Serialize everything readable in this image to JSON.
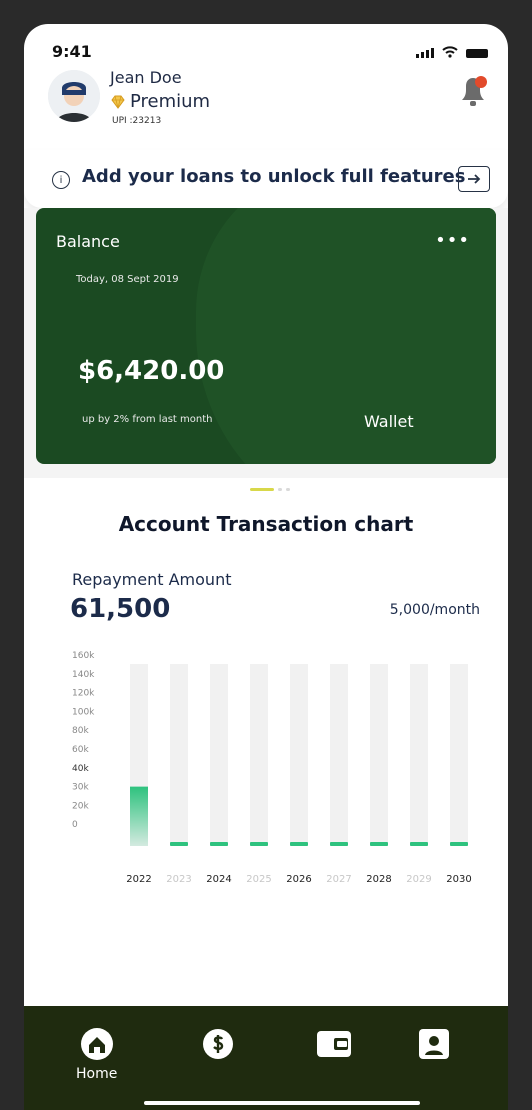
{
  "status": {
    "time": "9:41"
  },
  "profile": {
    "name": "Jean Doe",
    "plan": "Premium",
    "upi": "UPI :23213"
  },
  "banner": {
    "text": "Add your loans to unlock full features"
  },
  "balance_card": {
    "label": "Balance",
    "date": "Today, 08 Sept 2019",
    "amount": "$6,420.00",
    "change": "up by 2% from last month",
    "wallet": "Wallet",
    "more": "•••"
  },
  "section": {
    "title": "Account Transaction chart",
    "repayment_label": "Repayment Amount",
    "repayment_value": "61,500",
    "repayment_rate": "5,000/month"
  },
  "colors": {
    "accent": "#2ec27e",
    "card_green": "#1b4a22",
    "nav_bg": "#1f2b0f"
  },
  "chart_data": {
    "type": "bar",
    "categories": [
      "2022",
      "2023",
      "2024",
      "2025",
      "2026",
      "2027",
      "2028",
      "2029",
      "2030"
    ],
    "values": [
      50,
      0,
      0,
      0,
      0,
      0,
      0,
      0,
      0
    ],
    "ylim": [
      0,
      160
    ],
    "yticks": [
      "160k",
      "140k",
      "120k",
      "100k",
      "80k",
      "60k",
      "40k",
      "30k",
      "20k",
      "0"
    ],
    "units": "k"
  },
  "nav": {
    "items": [
      {
        "icon": "home-icon",
        "label": "Home"
      },
      {
        "icon": "dollar-icon",
        "label": ""
      },
      {
        "icon": "wallet-icon",
        "label": ""
      },
      {
        "icon": "profile-icon",
        "label": ""
      }
    ]
  }
}
